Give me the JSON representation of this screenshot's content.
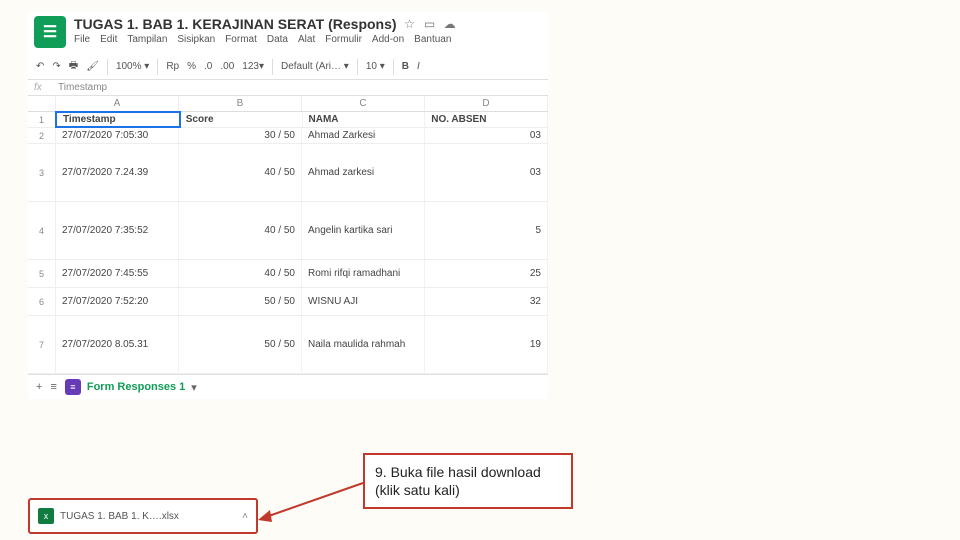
{
  "doc": {
    "title": "TUGAS 1. BAB 1. KERAJINAN SERAT (Respons)"
  },
  "menu": [
    "File",
    "Edit",
    "Tampilan",
    "Sisipkan",
    "Format",
    "Data",
    "Alat",
    "Formulir",
    "Add-on",
    "Bantuan"
  ],
  "toolbar": {
    "zoom": "100%",
    "currency": "Rp",
    "pct": "%",
    "dec0": ".0",
    "dec00": ".00",
    "fmt": "123",
    "font": "Default (Ari…",
    "size": "10",
    "bold": "B",
    "italic": "I"
  },
  "formula": {
    "label": "fx",
    "value": "Timestamp"
  },
  "columns": [
    "A",
    "B",
    "C",
    "D"
  ],
  "table": {
    "headers": [
      "Timestamp",
      "Score",
      "NAMA",
      "NO. ABSEN"
    ],
    "rows": [
      {
        "n": "1",
        "h": "h16",
        "c": [
          "Timestamp",
          "Score",
          "NAMA",
          "NO. ABSEN"
        ],
        "hdr": true
      },
      {
        "n": "2",
        "h": "h16",
        "c": [
          "27/07/2020 7:05:30",
          "30 / 50",
          "Ahmad Zarkesi",
          "03"
        ]
      },
      {
        "n": "3",
        "h": "h58",
        "c": [
          "27/07/2020 7.24.39",
          "40 / 50",
          "Ahmad zarkesi",
          "03"
        ]
      },
      {
        "n": "4",
        "h": "h58",
        "c": [
          "27/07/2020 7:35:52",
          "40 / 50",
          "Angelin kartika sari",
          "5"
        ]
      },
      {
        "n": "5",
        "h": "h28",
        "c": [
          "27/07/2020 7:45:55",
          "40 / 50",
          "Romi rifqi ramadhani",
          "25"
        ]
      },
      {
        "n": "6",
        "h": "h28",
        "c": [
          "27/07/2020 7:52:20",
          "50 / 50",
          "WISNU AJI",
          "32"
        ]
      },
      {
        "n": "7",
        "h": "h58",
        "c": [
          "27/07/2020 8.05.31",
          "50 / 50",
          "Naila maulida rahmah",
          "19"
        ]
      }
    ]
  },
  "sheet_tab": {
    "name": "Form Responses 1",
    "caret": "▾",
    "plus": "+",
    "menu": "≡"
  },
  "download": {
    "filename": "TUGAS 1. BAB 1. K….xlsx",
    "chevron": "˄"
  },
  "callout": {
    "text": "9. Buka file hasil download (klik satu kali)"
  }
}
